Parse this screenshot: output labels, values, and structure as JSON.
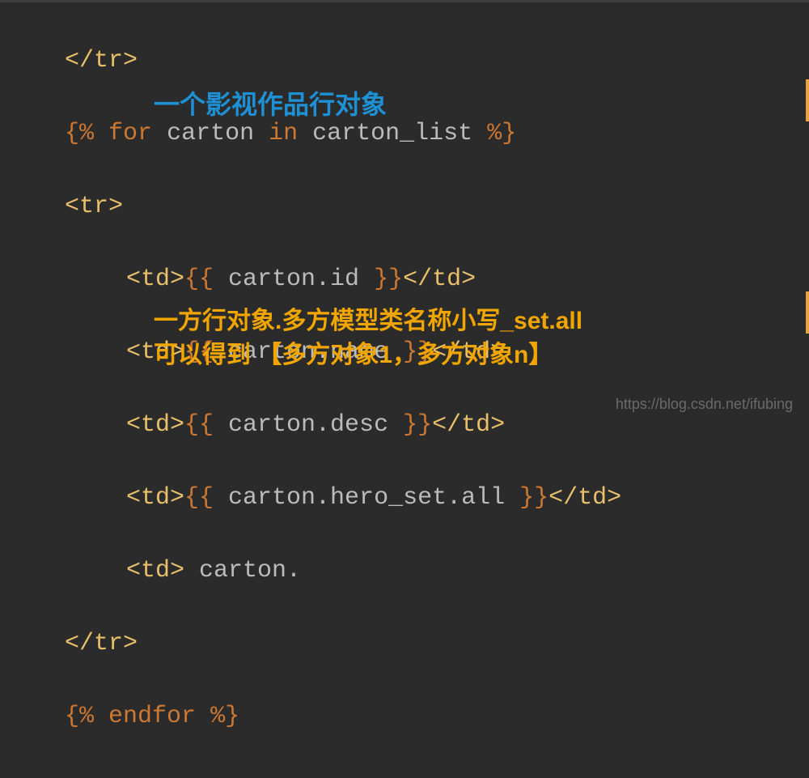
{
  "code": {
    "line1_close_tr": "</tr>",
    "line2": {
      "open": "{%",
      "for": "for",
      "var": "carton",
      "in": "in",
      "list": "carton_list",
      "close": "%}"
    },
    "line3_open_tr": "<tr>",
    "line4": {
      "td_open": "<td>",
      "expr_open": "{{",
      "expr": " carton.id ",
      "expr_close": "}}",
      "td_close": "</td>"
    },
    "line5": {
      "td_open": "<td>",
      "expr_open": "{{",
      "expr": " carton.name ",
      "expr_close": "}}",
      "td_close": "</td>"
    },
    "line6": {
      "td_open": "<td>",
      "expr_open": "{{",
      "expr": " carton.desc ",
      "expr_close": "}}",
      "td_close": "</td>"
    },
    "line7": {
      "td_open": "<td>",
      "expr_open": "{{",
      "expr": " carton.hero_set.all ",
      "expr_close": "}}",
      "td_close": "</td>"
    },
    "line8": {
      "td_open": "<td>",
      "partial": " carton."
    },
    "line9_close_tr": "</tr>",
    "line10": {
      "open": "{%",
      "endfor": "endfor",
      "close": "%}"
    }
  },
  "annotations": {
    "note1": "一个影视作品行对象",
    "note2_line1": "一方行对象.多方模型类名称小写_set.all",
    "note2_line2": "可以得到   【多方对象1，多方对象n】"
  },
  "watermark": "https://blog.csdn.net/ifubing"
}
